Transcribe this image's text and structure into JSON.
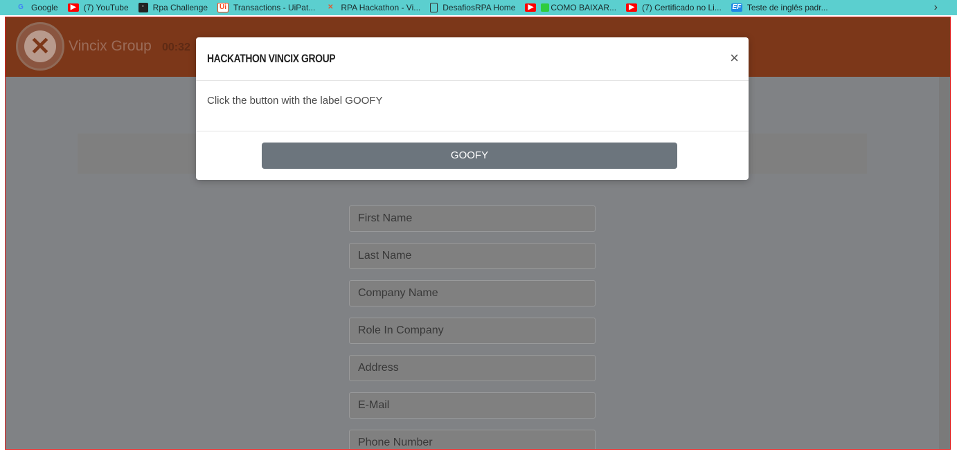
{
  "bookmarks": [
    {
      "icon": "google-icon",
      "label": "Google"
    },
    {
      "icon": "youtube-icon",
      "label": "(7) YouTube"
    },
    {
      "icon": "robot-icon",
      "label": "Rpa Challenge"
    },
    {
      "icon": "uipath-icon",
      "label": "Transactions - UiPat..."
    },
    {
      "icon": "rpa-hackathon-icon",
      "label": "RPA Hackathon - Vi..."
    },
    {
      "icon": "document-icon",
      "label": "DesafiosRPA Home"
    },
    {
      "icon": "youtube-icon",
      "label": "COMO BAIXAR..."
    },
    {
      "icon": "youtube-icon",
      "label": "(7) Certificado no Li..."
    },
    {
      "icon": "ef-icon",
      "label": "Teste de inglês padr..."
    }
  ],
  "header": {
    "brand": "Vincix Group",
    "timer": "00:32"
  },
  "form": {
    "fields": [
      "First Name",
      "Last Name",
      "Company Name",
      "Role In Company",
      "Address",
      "E-Mail",
      "Phone Number"
    ]
  },
  "modal": {
    "title": "HACKATHON VINCIX GROUP",
    "close": "×",
    "message": "Click the button with the label GOOFY",
    "button": "GOOFY"
  },
  "colors": {
    "bookmark_bar": "#5bcfcf",
    "navbar": "#7c3719",
    "overlay": "#808285",
    "button": "#6c757d"
  }
}
